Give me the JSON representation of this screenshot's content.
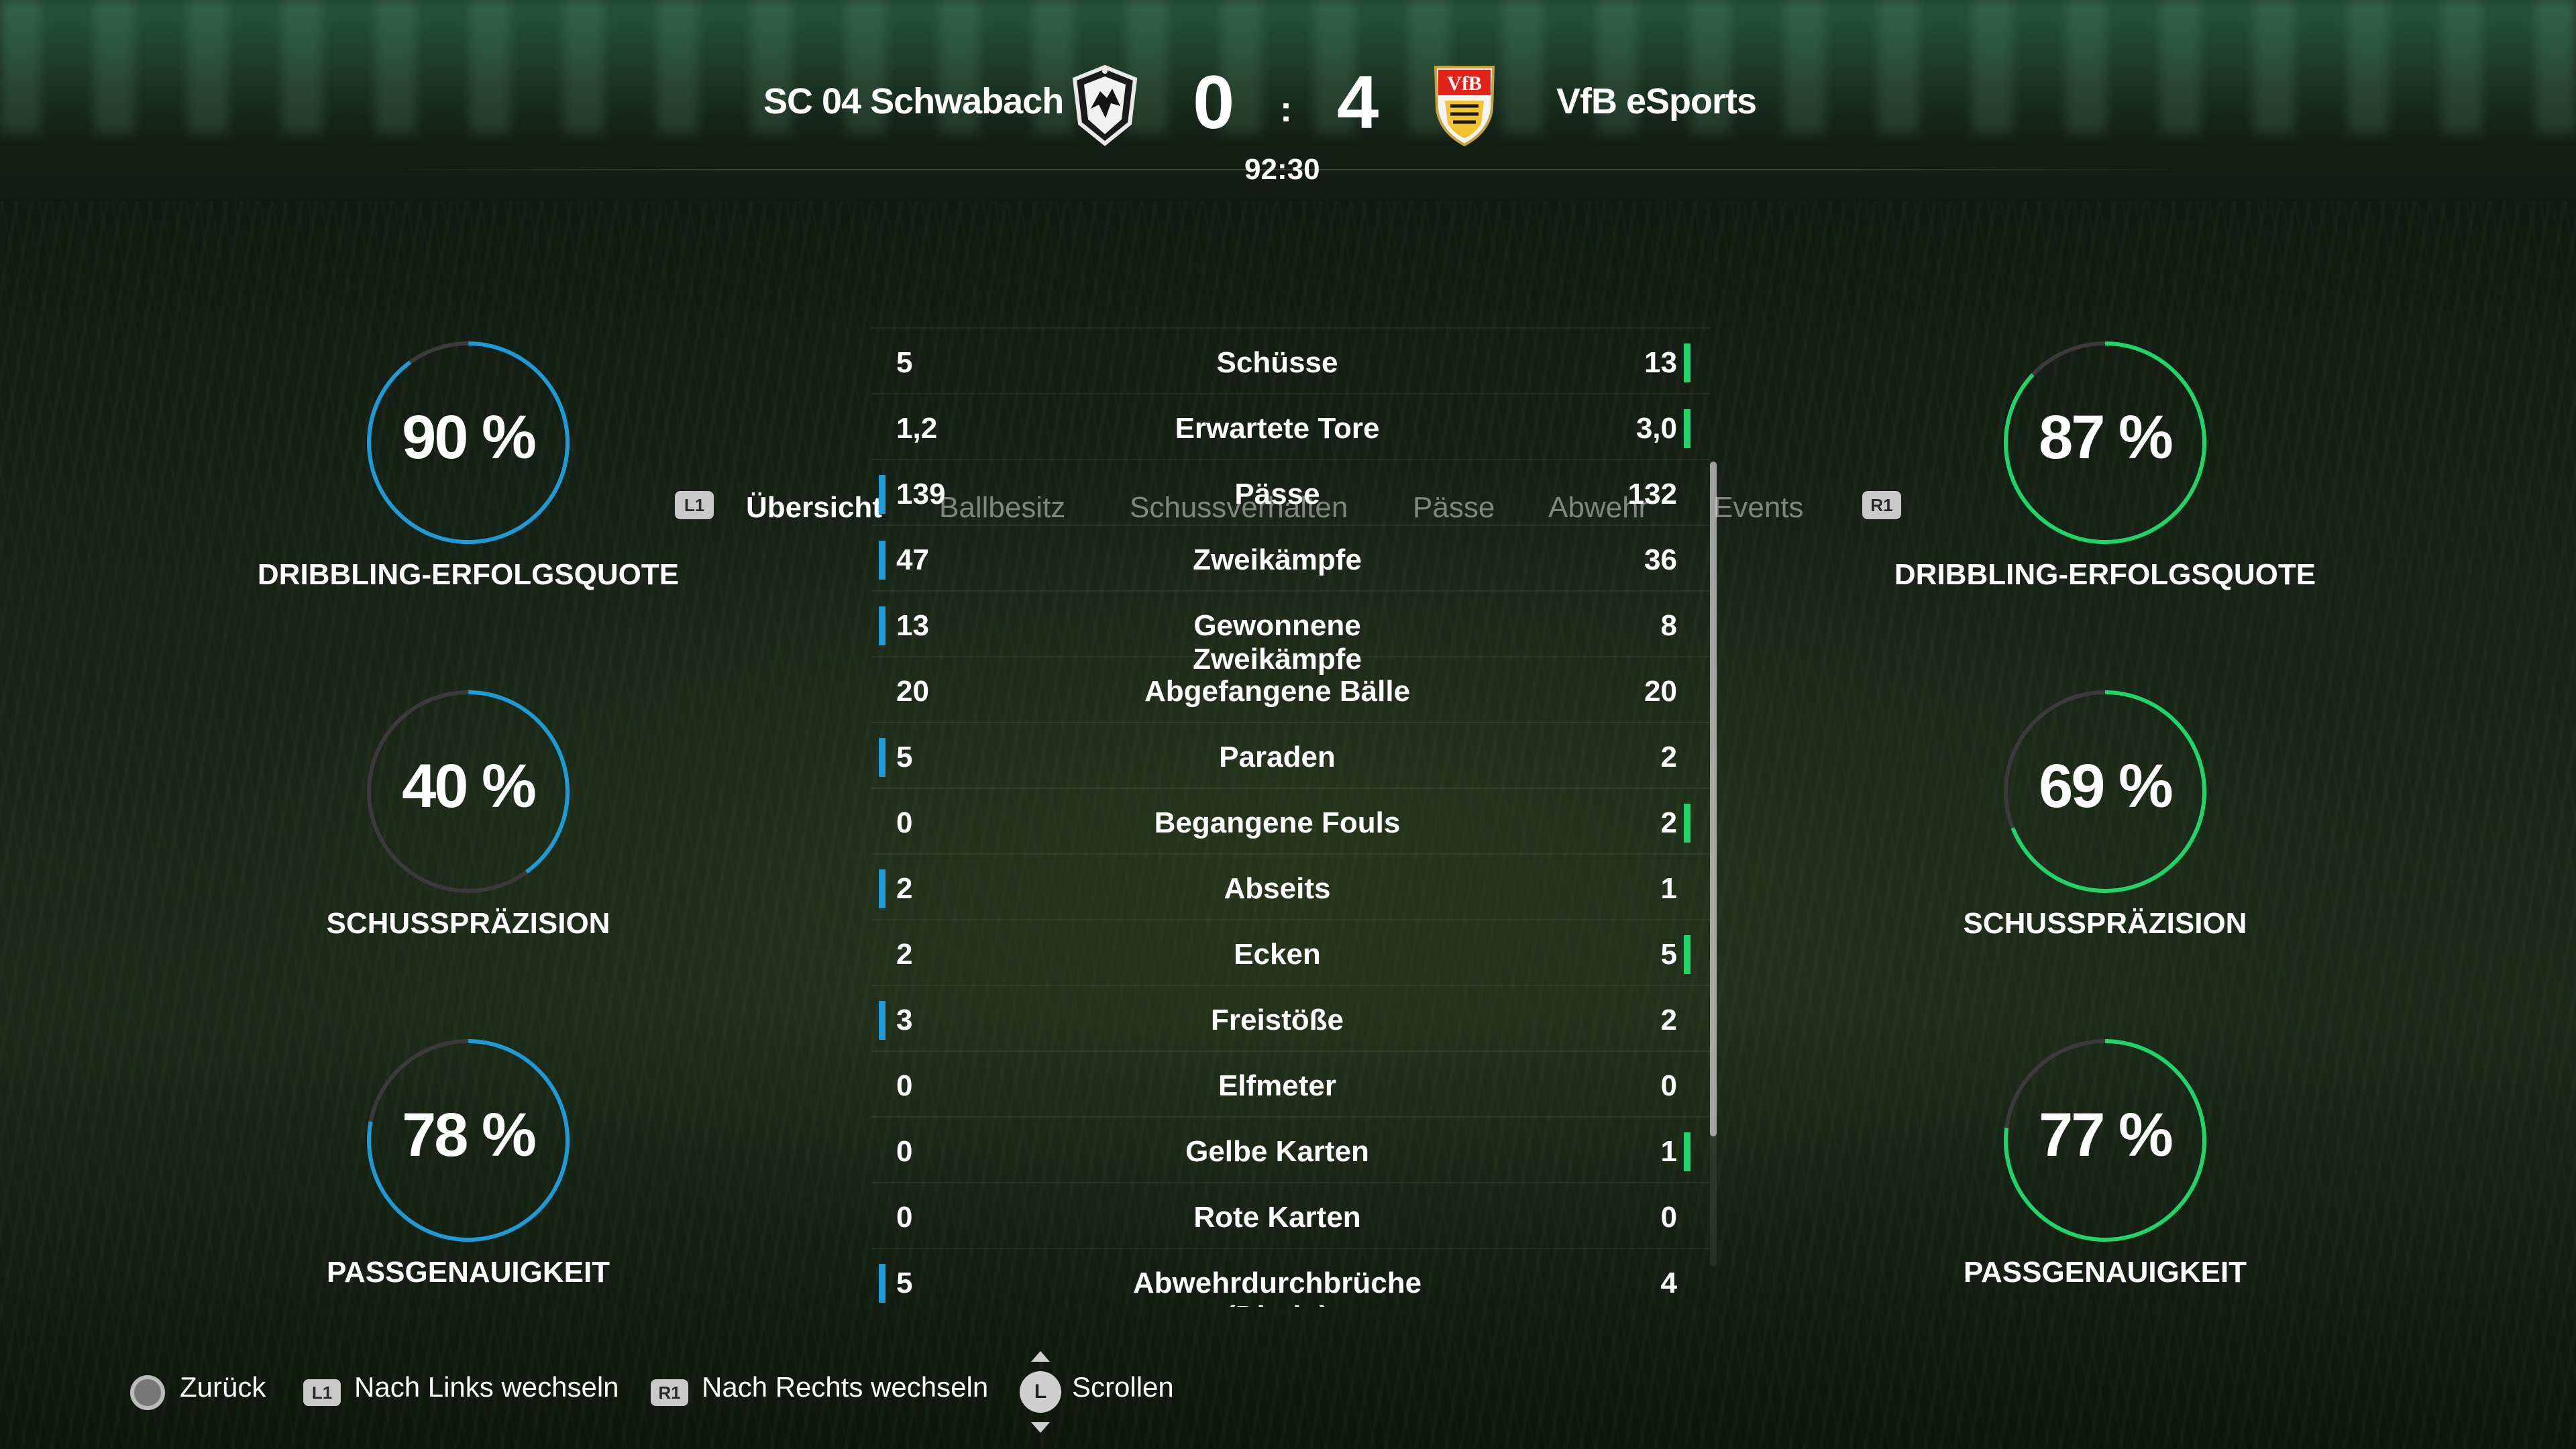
{
  "match": {
    "home_team": "SC 04 Schwabach",
    "away_team": "VfB eSports",
    "home_score": "0",
    "away_score": "4",
    "separator": ":",
    "clock": "92:30"
  },
  "tabs": {
    "left_shoulder": "L1",
    "right_shoulder": "R1",
    "items": [
      "Übersicht",
      "Ballbesitz",
      "Schussverhalten",
      "Pässe",
      "Abwehr",
      "Events"
    ],
    "active": "Übersicht"
  },
  "home_rings": [
    {
      "value": "90 %",
      "percent": 90,
      "label": "DRIBBLING-ERFOLGSQUOTE"
    },
    {
      "value": "40 %",
      "percent": 40,
      "label": "SCHUSSPRÄZISION"
    },
    {
      "value": "78 %",
      "percent": 78,
      "label": "PASSGENAUIGKEIT"
    }
  ],
  "away_rings": [
    {
      "value": "87 %",
      "percent": 87,
      "label": "DRIBBLING-ERFOLGSQUOTE"
    },
    {
      "value": "69 %",
      "percent": 69,
      "label": "SCHUSSPRÄZISION"
    },
    {
      "value": "77 %",
      "percent": 77,
      "label": "PASSGENAUIGKEIT"
    }
  ],
  "colors": {
    "home_accent": "#1e9bd7",
    "away_accent": "#20d468",
    "ring_track": "#3a3a3a"
  },
  "stats": [
    {
      "label": "Schüsse",
      "home": "5",
      "away": "13",
      "leader": "away"
    },
    {
      "label": "Erwartete Tore",
      "home": "1,2",
      "away": "3,0",
      "leader": "away"
    },
    {
      "label": "Pässe",
      "home": "139",
      "away": "132",
      "leader": "home"
    },
    {
      "label": "Zweikämpfe",
      "home": "47",
      "away": "36",
      "leader": "home"
    },
    {
      "label": "Gewonnene Zweikämpfe",
      "home": "13",
      "away": "8",
      "leader": "home"
    },
    {
      "label": "Abgefangene Bälle",
      "home": "20",
      "away": "20",
      "leader": "none"
    },
    {
      "label": "Paraden",
      "home": "5",
      "away": "2",
      "leader": "home"
    },
    {
      "label": "Begangene Fouls",
      "home": "0",
      "away": "2",
      "leader": "away"
    },
    {
      "label": "Abseits",
      "home": "2",
      "away": "1",
      "leader": "home"
    },
    {
      "label": "Ecken",
      "home": "2",
      "away": "5",
      "leader": "away"
    },
    {
      "label": "Freistöße",
      "home": "3",
      "away": "2",
      "leader": "home"
    },
    {
      "label": "Elfmeter",
      "home": "0",
      "away": "0",
      "leader": "none"
    },
    {
      "label": "Gelbe Karten",
      "home": "0",
      "away": "1",
      "leader": "away"
    },
    {
      "label": "Rote Karten",
      "home": "0",
      "away": "0",
      "leader": "none"
    },
    {
      "label": "Abwehrdurchbrüche (Direkt)",
      "home": "5",
      "away": "4",
      "leader": "home"
    }
  ],
  "footer": {
    "back": "Zurück",
    "left_key": "L1",
    "left_switch": "Nach Links wechseln",
    "right_key": "R1",
    "right_switch": "Nach Rechts wechseln",
    "stick_key": "L",
    "scroll": "Scrollen"
  },
  "icons": {
    "home_crest": "schwabach-crest-icon",
    "away_crest": "vfb-crest-icon",
    "back": "circle-button-icon",
    "stick": "left-stick-icon"
  }
}
